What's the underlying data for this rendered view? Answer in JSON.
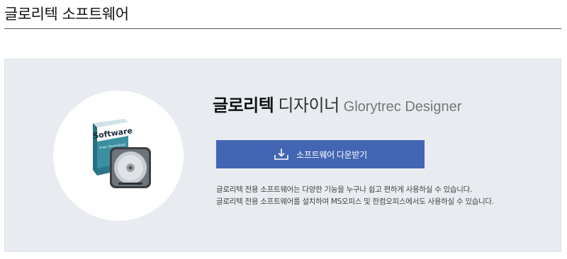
{
  "page": {
    "heading": "글로리텍 소프트웨어"
  },
  "product": {
    "brand": "글로리텍",
    "name": "디자이너",
    "name_en": "Glorytrec Designer",
    "box_label": "Software",
    "box_sublabel": "Free Download"
  },
  "download": {
    "label": "소프트웨어 다운받기",
    "icon": "download-icon"
  },
  "description": {
    "line1": "글로리텍 전용 소프트웨어는 다양한 기능을 누구나 쉽고 편하게 사용하실 수 있습니다.",
    "line2": "글로리텍 전용 소프트웨어를 설치하여 MS오피스 및 한컴오피스에서도 사용하실 수 있습니다."
  },
  "colors": {
    "button": "#4266b3",
    "panel": "#e8ebf0",
    "box_teal": "#3b8fa1"
  }
}
